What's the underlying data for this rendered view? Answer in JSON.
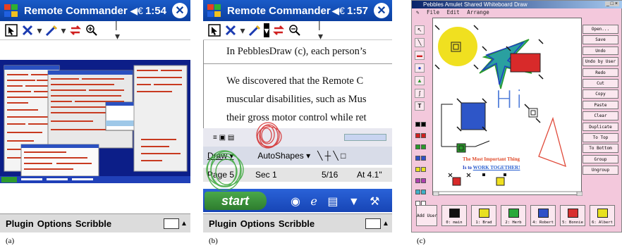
{
  "panel_a": {
    "title": {
      "app_name": "Remote Commander",
      "time": "1:54",
      "sound_glyph": "◀€",
      "close_glyph": "✕"
    },
    "bottom_menu": [
      "Plugin",
      "Options",
      "Scribble"
    ],
    "caption": "(a)"
  },
  "panel_b": {
    "title": {
      "app_name": "Remote Commander",
      "time": "1:57",
      "sound_glyph": "◀€",
      "close_glyph": "✕"
    },
    "document": {
      "line1": "In PebblesDraw (c), each person’s",
      "line2": "We discovered that the Remote C",
      "line3": "muscular disabilities, such as Mus",
      "line4": "their gross motor control while ret"
    },
    "draw_toolbar": {
      "draw": "Draw ▾",
      "autoshapes": "AutoShapes ▾"
    },
    "status_bar": {
      "page": "Page 5",
      "sec": "Sec 1",
      "pages": "5/16",
      "at": "At 4.1\""
    },
    "taskbar": {
      "start": "start"
    },
    "bottom_menu": [
      "Plugin",
      "Options",
      "Scribble"
    ],
    "caption": "(b)"
  },
  "panel_c": {
    "window_title": "Pebbles Amulet Shared Whiteboard Draw",
    "menu": [
      "File",
      "Edit",
      "Arrange"
    ],
    "buttons": [
      "Open...",
      "Save",
      "Undo",
      "Undo by User",
      "Redo",
      "Cut",
      "Copy",
      "Paste",
      "Clear",
      "Duplicate",
      "To Top",
      "To Bottom",
      "Group",
      "Ungroup"
    ],
    "canvas_text": {
      "line1": "The Most Important Thing",
      "line2_a": "Is to ",
      "line2_b": "WORK TOGETHER!",
      "hi": "Hi"
    },
    "add_user": "Add User",
    "users": [
      "0: main",
      "1: Brad",
      "2: Herb",
      "4: Robert",
      "5: Bonnie",
      "6: Albert"
    ],
    "user_colors": [
      "#111111",
      "#e8e020",
      "#2aa83a",
      "#3050c8",
      "#d83030",
      "#e8e020"
    ],
    "palette_colors": [
      "#000000",
      "#d02020",
      "#2a9a2a",
      "#3050c8",
      "#e8e020",
      "#b040b0",
      "#40b0c8",
      "#ffffff"
    ],
    "caption": "(c)"
  }
}
